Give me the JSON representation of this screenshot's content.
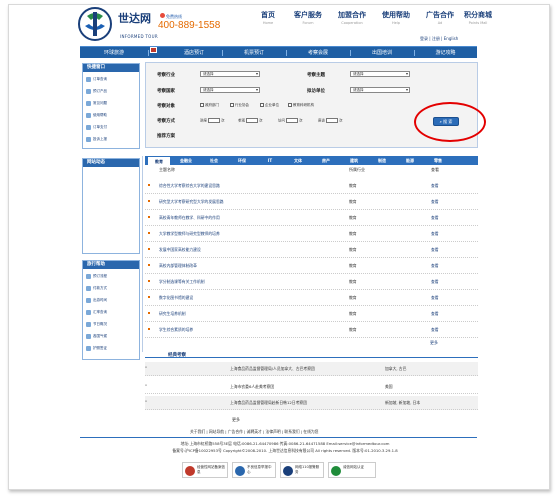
{
  "header": {
    "brand_cn": "世达网",
    "brand_en": "INFORMED TOUR",
    "hotline_label": "免费热线",
    "hotline_number": "400-889-1558",
    "user_links": "登录 | 注册 | English",
    "top_nav": [
      {
        "cn": "首页",
        "en": "Home"
      },
      {
        "cn": "客户服务",
        "en": "Forum"
      },
      {
        "cn": "加盟合作",
        "en": "Cooperation"
      },
      {
        "cn": "使用帮助",
        "en": "Help"
      },
      {
        "cn": "广告合作",
        "en": "Ad"
      },
      {
        "cn": "积分商城",
        "en": "Points Mall"
      }
    ]
  },
  "main_nav": [
    "环球旅游",
    "酒店预订",
    "机票预订",
    "考察会展",
    "出国培训",
    "游记攻略"
  ],
  "sidebar": {
    "quick_title": "快捷窗口",
    "quick_items": [
      "订单查询",
      "预订产品",
      "常见问题",
      "使用帮助",
      "订单支付",
      "投诉上报"
    ],
    "news_title": "网站动态",
    "guide_title": "旅行帮助",
    "guide_items": [
      "预订流程",
      "付款方式",
      "出游时间",
      "汇率查询",
      "节日概况",
      "各国气候",
      "护照签证"
    ]
  },
  "search": {
    "row1": {
      "label_a": "考察行业",
      "select_a": "请选择",
      "label_b": "考察主题",
      "select_b": "请选择"
    },
    "row2": {
      "label_a": "考察国家",
      "select_a": "请选择",
      "label_b": "拟访单位",
      "select_b": "请选择"
    },
    "target_label": "考察对象",
    "targets": [
      "政府部门",
      "行业协会",
      "企业单位",
      "教育科研机构"
    ],
    "method_label": "考察方式",
    "methods": [
      {
        "label": "讲座",
        "unit": "次"
      },
      {
        "label": "参观",
        "unit": "次"
      },
      {
        "label": "访问",
        "unit": "次"
      },
      {
        "label": "座谈",
        "unit": "次"
      }
    ],
    "plan_label": "推荐方案",
    "button": "搜 索"
  },
  "tabs": [
    "教育",
    "金融业",
    "社会",
    "环保",
    "IT",
    "文体",
    "房产",
    "建筑",
    "制造",
    "能源",
    "零售"
  ],
  "table": {
    "headers": [
      "主题名称",
      "所属行业",
      "查看"
    ],
    "rows": [
      {
        "title": "综合性大学考察综合大学的建设思路",
        "industry": "教育",
        "view": "查看"
      },
      {
        "title": "研究型大学考察研究型大学的发展思路",
        "industry": "教育",
        "view": "查看"
      },
      {
        "title": "高校青年教师在教学、科研中的作用",
        "industry": "教育",
        "view": "查看"
      },
      {
        "title": "大学教学型教师与研究型教师的培养",
        "industry": "教育",
        "view": "查看"
      },
      {
        "title": "发展中国家高校能力建设",
        "industry": "教育",
        "view": "查看"
      },
      {
        "title": "高校内部管理体制改革",
        "industry": "教育",
        "view": "查看"
      },
      {
        "title": "学分制选课等有关工作机制",
        "industry": "教育",
        "view": "查看"
      },
      {
        "title": "数字化图书馆的建设",
        "industry": "教育",
        "view": "查看"
      },
      {
        "title": "研究生培养机制",
        "industry": "教育",
        "view": "查看"
      },
      {
        "title": "学生综合素质的培养",
        "industry": "教育",
        "view": "查看"
      }
    ],
    "more": "更多"
  },
  "classic": {
    "title": "经典考察",
    "rows": [
      {
        "title": "上海食品药品监督管理局/人员加拿大、古巴考察团",
        "country": "加拿大, 古巴"
      },
      {
        "title": "上海市农委6人赴美考察团",
        "country": "美国"
      },
      {
        "title": "上海食品药品监督管理局赴新日韩12日考察团",
        "country": "新加坡, 新加坡, 日本"
      }
    ],
    "more": "更多"
  },
  "footer": {
    "links": "关于我们 | 网站导航 | 广告合作 | 诚聘英才 | 法律声明 | 联系我们 | 在线为您",
    "address": "地址:上海市虹桥路558号3E层  电话:0086-21-64470986  传真:0086-21-64471588  Email:service@informedtour.com",
    "copyright": "备案号:沪ICP备10022953号 Copyright©2008-2010. 上海世达信息科技有限公司 All rights reserved. 版本号:01.2010.3.29.1.8",
    "badges": [
      "经营性网站备案信息",
      "不良信息举报中心",
      "网络110报警服务",
      "诚信网站认证"
    ]
  },
  "colors": {
    "nav_blue": "#1f5fa4",
    "brand_orange": "#e46a00",
    "annotation_red": "#e30000"
  }
}
